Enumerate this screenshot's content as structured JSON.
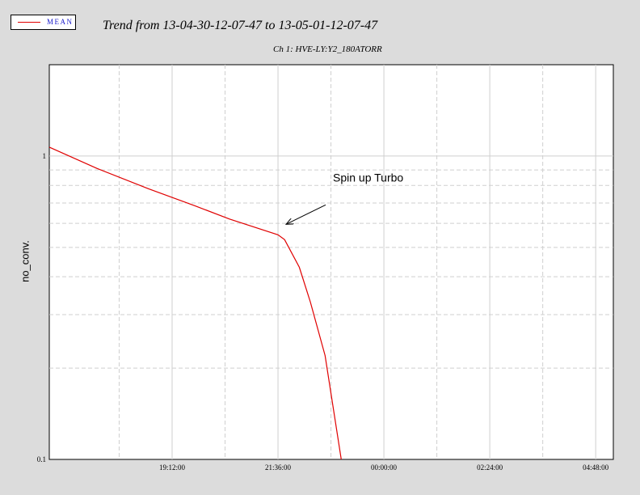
{
  "legend": {
    "label": "MEAN"
  },
  "title": "Trend from 13-04-30-12-07-47 to 13-05-01-12-07-47",
  "subtitle": "Ch 1: HVE-LY:Y2_180ATORR",
  "colors": {
    "series": "#e00000",
    "background": "#dcdcdc",
    "plot": "#ffffff"
  },
  "chart_data": {
    "type": "line",
    "title": "Trend from 13-04-30-12-07-47 to 13-05-01-12-07-47",
    "subtitle": "Ch 1: HVE-LY:Y2_180ATORR",
    "xlabel": "",
    "ylabel": "no_conv.",
    "yscale": "log",
    "ylim": [
      0.1,
      2.0
    ],
    "xlim": [
      "16:25:00",
      "05:12:00"
    ],
    "x_tick_labels": [
      "19:12:00",
      "21:36:00",
      "00:00:00",
      "02:24:00",
      "04:48:00"
    ],
    "y_tick_labels": [
      "1",
      "0.1"
    ],
    "grid": true,
    "legend_position": "top-left",
    "series": [
      {
        "name": "MEAN",
        "x": [
          "16:25:00",
          "17:30:00",
          "18:40:00",
          "19:40:00",
          "20:30:00",
          "21:36:00",
          "21:45:00",
          "22:05:00",
          "22:20:00",
          "22:40:00",
          "23:02:00"
        ],
        "y": [
          1.07,
          0.91,
          0.78,
          0.69,
          0.62,
          0.55,
          0.53,
          0.43,
          0.33,
          0.22,
          0.1
        ]
      }
    ],
    "annotations": [
      {
        "text": "Spin up Turbo",
        "x": "21:36:00",
        "y": 0.55
      }
    ]
  }
}
